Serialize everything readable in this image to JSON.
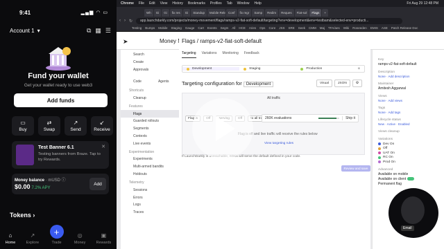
{
  "phone": {
    "status_time": "9:41",
    "status_icons": "▂▄▆ ◠ ▭",
    "account_label": "Account 1",
    "account_chevron": "▾",
    "icons": {
      "copy": "⧉",
      "qr": "▦",
      "menu": "☰"
    },
    "heading": "Fund your wallet",
    "subheading": "Get your wallet ready to use web3",
    "add_funds_label": "Add funds",
    "actions": [
      {
        "label": "Buy",
        "icon": "▭"
      },
      {
        "label": "Swap",
        "icon": "⇄"
      },
      {
        "label": "Send",
        "icon": "↗"
      },
      {
        "label": "Receive",
        "icon": "↙"
      }
    ],
    "banner": {
      "title": "Test Banner 6.1",
      "description": "Testing banners from Braze. Tap to try Rewards.",
      "close": "✕"
    },
    "balance": {
      "label": "Money balance",
      "sub": "· mUSD ⓘ",
      "value": "$0.00",
      "apy": "7.2% APY",
      "add_label": "Add"
    },
    "tokens_label": "Tokens ›",
    "nav": [
      {
        "label": "Home",
        "icon": "⌂",
        "active": true
      },
      {
        "label": "Explore",
        "icon": "↗"
      },
      {
        "label": "Trade",
        "icon": "+"
      },
      {
        "label": "Money",
        "icon": "◎"
      },
      {
        "label": "Rewards",
        "icon": "▣"
      }
    ]
  },
  "browser": {
    "menubar": [
      "Chrome",
      "File",
      "Edit",
      "View",
      "History",
      "Bookmarks",
      "Profiles",
      "Tab",
      "Window",
      "Help"
    ],
    "menubar_right": "Fri Aug 29  12:48 PM",
    "tabs": [
      "Wh",
      "Gi",
      "Gi",
      "fix res",
      "Gi",
      "Standup",
      "Mobile Release",
      "Conf",
      "fix regr",
      "Samp",
      "Redim",
      "Reques",
      "Fiat-sol",
      "Flags",
      "+"
    ],
    "active_tab_index": 13,
    "url": "app.launchdarkly.com/projects/money-movement/flags/ramps-v2-fiat-soft-default/targeting?env=development&env=testbam&selected-env=producti...",
    "bookmarks": [
      "Testing",
      "Bumps",
      "Mobile",
      "Staging",
      "Gauge",
      "Cart",
      "Events",
      "Segm",
      "All",
      "HCE",
      "Aries",
      "Ops",
      "Core",
      "JSS",
      "SRE",
      "Seek",
      "CMM",
      "Maj",
      "TFA/aes",
      "Wiki",
      "Roseeden",
      "EMIS",
      "ASE",
      "Patch Release Doc"
    ],
    "ld_header": "Money Movement",
    "breadcrumb": "Flags / ramps-v2-fiat-soft-default",
    "tabs_main": [
      "Targeting",
      "Variations",
      "Monitoring",
      "Feedback"
    ],
    "envs": [
      {
        "name": "Development",
        "color": "#f0c23a",
        "active": true
      },
      {
        "name": "Staging",
        "color": "#f0c23a"
      },
      {
        "name": "Production",
        "color": "#9ad04b"
      }
    ],
    "env_add": "+",
    "targeting_title": "Targeting configuration for",
    "targeting_env": "Development",
    "view_buttons": [
      "Visual",
      "JSON",
      "⚙"
    ],
    "all_traffic": "All traffic",
    "flow": [
      "Flag is",
      "Off",
      "serving",
      "Off",
      "to all traffic"
    ],
    "evaluations": "260K evaluations",
    "eval_fraction": 0.85,
    "ship_it": "Ship it",
    "off_note": "Flag is off and live traffic will receive the rules below",
    "view_link": "View targeting rules",
    "footer_note": "If LaunchDarkly is unreachable, SDKs will serve the default defined in your code.",
    "review_label": "Review and save",
    "nav_items": [
      {
        "type": "item",
        "label": "Search"
      },
      {
        "type": "item",
        "label": "Create"
      },
      {
        "type": "item",
        "label": "Approvals"
      },
      {
        "type": "item",
        "label": "Code"
      },
      {
        "type": "section",
        "label": "Shortcuts"
      },
      {
        "type": "item",
        "label": "Cleanup"
      },
      {
        "type": "section",
        "label": "Features"
      },
      {
        "type": "item",
        "label": "Flags",
        "active": true
      },
      {
        "type": "item",
        "label": "Guarded rollouts"
      },
      {
        "type": "item",
        "label": "Segments"
      },
      {
        "type": "item",
        "label": "Contexts"
      },
      {
        "type": "item",
        "label": "Live events"
      },
      {
        "type": "section",
        "label": "Experimentation"
      },
      {
        "type": "item",
        "label": "Experiments"
      },
      {
        "type": "item",
        "label": "Multi-armed bandits"
      },
      {
        "type": "item",
        "label": "Holdouts"
      },
      {
        "type": "section",
        "label": "Telemetry"
      },
      {
        "type": "item",
        "label": "Sessions"
      },
      {
        "type": "item",
        "label": "Errors"
      },
      {
        "type": "item",
        "label": "Logs"
      },
      {
        "type": "item",
        "label": "Traces"
      }
    ],
    "agents_label": "Agents",
    "right_panel": {
      "key_label": "Key",
      "key_value": "ramps-v2-fiat-soft-default",
      "description_label": "Description",
      "description_value": "None · Add description",
      "maintainer_label": "Maintainer",
      "maintainer_value": "Amitesh Aggarwal",
      "views_label": "Views",
      "views_value": "None · Add views",
      "tags_label": "Tags",
      "tags_value": "None · Add tags",
      "lifecycle_label": "Lifecycle status",
      "lifecycle_value": "New · Active · Enabled",
      "cleanup_label": "Views cleanup",
      "variations_label": "Variations",
      "variations": [
        {
          "name": "Dev On",
          "color": "#3b5bdb"
        },
        {
          "name": "Off",
          "color": "#e0a23a"
        },
        {
          "name": "UAT On",
          "color": "#d04ba8"
        },
        {
          "name": "RC On",
          "color": "#46c47a"
        },
        {
          "name": "Prod On",
          "color": "#b46ad0"
        }
      ],
      "advanced_label": "Advanced",
      "available_mobile": "Available on mobile",
      "available_client": "Available on client",
      "permanent_flag": "Permanent flag"
    },
    "cam_name": "Email"
  }
}
